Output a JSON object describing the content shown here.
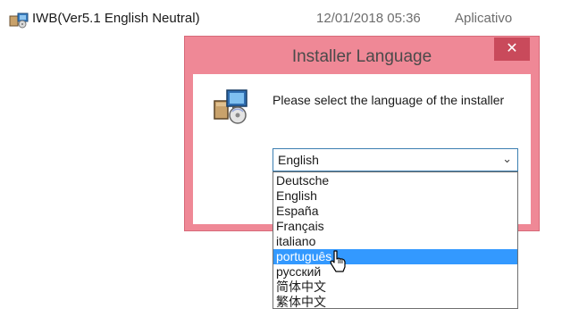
{
  "file_row": {
    "name": "IWB(Ver5.1 English Neutral)",
    "date": "12/01/2018 05:36",
    "type": "Aplicativo",
    "icon": "installer-package-icon"
  },
  "dialog": {
    "title": "Installer Language",
    "close_label": "✕",
    "prompt": "Please select the language of the installer",
    "icon": "installer-icon",
    "colors": {
      "frame": "#ef8896",
      "close": "#c94a5b",
      "selection": "#3399ff"
    }
  },
  "language_select": {
    "selected": "English",
    "options": [
      "Deutsche",
      "English",
      "España",
      "Français",
      "italiano",
      "português",
      "русский",
      "简体中文",
      "繁体中文"
    ],
    "highlighted_index": 5
  }
}
